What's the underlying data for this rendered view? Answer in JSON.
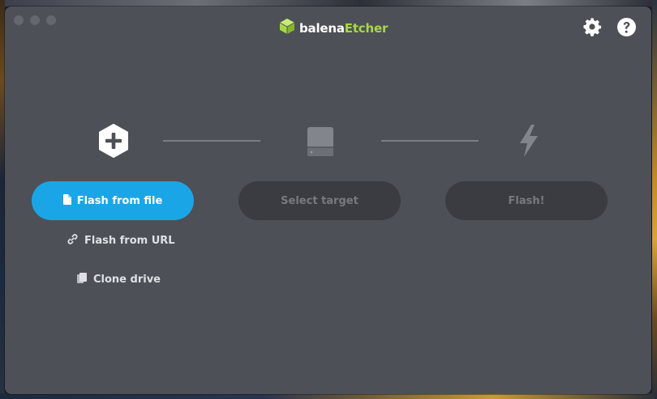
{
  "app": {
    "brand_prefix": "balena",
    "brand_suffix": "Etcher",
    "brand_accent": "#a6d845"
  },
  "header": {
    "settings_icon": "gear-icon",
    "help_icon": "question-circle-icon"
  },
  "steps": {
    "source": {
      "icon": "plus-hexagon-icon",
      "button_label": "Flash from file",
      "button_icon": "file-icon"
    },
    "target": {
      "icon": "drive-icon",
      "button_label": "Select target"
    },
    "flash": {
      "icon": "lightning-icon",
      "button_label": "Flash!"
    }
  },
  "source_options": {
    "url_label": "Flash from URL",
    "url_icon": "link-icon",
    "clone_label": "Clone drive",
    "clone_icon": "copy-icon"
  },
  "colors": {
    "window_bg": "#4d5057",
    "primary": "#1aa6e6",
    "disabled_bg": "#3a3c41",
    "disabled_text": "#777a80"
  }
}
